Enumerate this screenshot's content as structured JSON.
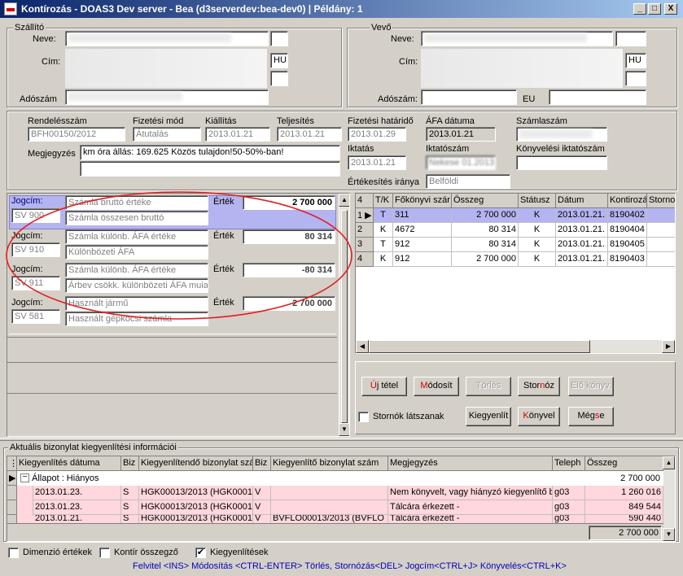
{
  "window": {
    "title": "Kontírozás - DOAS3 Dev server - Bea (d3serverdev:bea-dev0) | Példány: 1",
    "min": "_",
    "max": "□",
    "close": "X"
  },
  "seller": {
    "group": "Szállító",
    "name_label": "Neve:",
    "address_label": "Cím:",
    "country": "HU",
    "taxno_label": "Adószám"
  },
  "buyer": {
    "group": "Vevő",
    "name_label": "Neve:",
    "address_label": "Cím:",
    "country": "HU",
    "taxno_label": "Adószám:",
    "eu_label": "EU"
  },
  "invoice": {
    "order_no_label": "Rendelésszám",
    "order_no": "BFH00150/2012",
    "pay_mode_label": "Fizetési mód",
    "pay_mode": "Átutalás",
    "issue_label": "Kiállítás",
    "issue": "2013.01.21",
    "perf_label": "Teljesítés",
    "perf": "2013.01.21",
    "due_label": "Fizetési határidő",
    "due": "2013.01.29",
    "vat_date_label": "ÁFA dátuma",
    "vat_date": "2013.01.21",
    "inv_no_label": "Számlaszám",
    "note_label": "Megjegyzés",
    "note": "km óra állás: 169.625  Közös tulajdon!50-50%-ban!",
    "filing_label": "Iktatás",
    "filing": "2013.01.21",
    "filing_no_label": "Iktatószám",
    "filing_no": "Nekese 01.2013",
    "acc_filing_label": "Könyvelési iktatószám",
    "sale_dir_label": "Értékesítés iránya",
    "sale_dir": "Belföldi"
  },
  "jogcim": {
    "label": "Jogcím:",
    "value_label": "Érték",
    "rows": [
      {
        "code": "SV 900",
        "name": "Számla bruttó értéke",
        "desc": "Számla összesen bruttó",
        "value": "2 700 000"
      },
      {
        "code": "SV 910",
        "name": "Számla különb. ÁFA értéke",
        "desc": "Különbözeti ÁFA",
        "value": "80 314"
      },
      {
        "code": "SV 911",
        "name": "Számla különb. ÁFA értéke",
        "desc": "Árbev csökk. különbözeti ÁFA muiatt",
        "value": "-80 314"
      },
      {
        "code": "SV 581",
        "name": "Használt jármű",
        "desc": "Használt gépkocsi számla",
        "value": "2 700 000"
      }
    ]
  },
  "ledger": {
    "corner": "4",
    "headers": [
      "T/K",
      "Főkönyvi szár",
      "Összeg",
      "Státusz",
      "Dátum",
      "Kontirozá",
      "Storno"
    ],
    "rows": [
      {
        "n": "1",
        "tk": "T",
        "acct": "311",
        "amount": "2 700 000",
        "status": "K",
        "date": "2013.01.21.",
        "kont": "8190402"
      },
      {
        "n": "2",
        "tk": "K",
        "acct": "4672",
        "amount": "80 314",
        "status": "K",
        "date": "2013.01.21.",
        "kont": "8190404"
      },
      {
        "n": "3",
        "tk": "T",
        "acct": "912",
        "amount": "80 314",
        "status": "K",
        "date": "2013.01.21.",
        "kont": "8190405"
      },
      {
        "n": "4",
        "tk": "K",
        "acct": "912",
        "amount": "2 700 000",
        "status": "K",
        "date": "2013.01.21.",
        "kont": "8190403"
      }
    ]
  },
  "buttons": {
    "new": "Új tétel",
    "modify": "Módosít",
    "delete": "Törlés",
    "storno": "Stornóz",
    "prev": "Elő könyv.",
    "show_storno": "Stornók látszanak",
    "settle": "Kiegyenlít",
    "book": "Könyvel",
    "cancel": "Mégse"
  },
  "settlement": {
    "group": "Aktuális bizonylat kiegyenlítési információi",
    "headers": [
      "Kiegyenlítés dátuma",
      "Biz",
      "Kiegyenlítendő bizonylat szá",
      "Biz",
      "Kiegyenlítő bizonylat szám",
      "Megjegyzés",
      "Teleph",
      "Összeg"
    ],
    "group_row": {
      "label": "Állapot : Hiányos",
      "amount": "2 700 000"
    },
    "rows": [
      {
        "date": "2013.01.23.",
        "b1": "S",
        "doc": "HGK00013/2013 (HGK0001",
        "b2": "V",
        "doc2": "",
        "note": "Nem könyvelt, vagy hiányzó kiegyenlítő bi",
        "site": "g03",
        "amount": "1 260 016"
      },
      {
        "date": "2013.01.23.",
        "b1": "S",
        "doc": "HGK00013/2013 (HGK0001",
        "b2": "V",
        "doc2": "",
        "note": "Tálcára érkezett -",
        "site": "g03",
        "amount": "849 544"
      },
      {
        "date": "2013.01.21.",
        "b1": "S",
        "doc": "HGK00013/2013 (HGK0001",
        "b2": "V",
        "doc2": "BVFLO00013/2013 (BVFLO",
        "note": "Tálcára érkezett -",
        "site": "g03",
        "amount": "590 440"
      }
    ],
    "total": "2 700 000"
  },
  "footer": {
    "dim": "Dimenzió értékek",
    "kontir": "Kontír összegző",
    "kieg": "Kiegyenlítések",
    "kieg_checked": "✔",
    "hint": "Felvitel <INS> Módosítás <CTRL-ENTER> Törlés, Stornózás<DEL> Jogcím<CTRL+J> Könyvelés<CTRL+K>"
  },
  "colors": {
    "title_start": "#0a246a",
    "title_end": "#a6caf0",
    "selected_row": "#b4b4f0",
    "pink_row": "#ffd7dc",
    "ellipse": "#e02020",
    "hint": "#0000c0"
  }
}
